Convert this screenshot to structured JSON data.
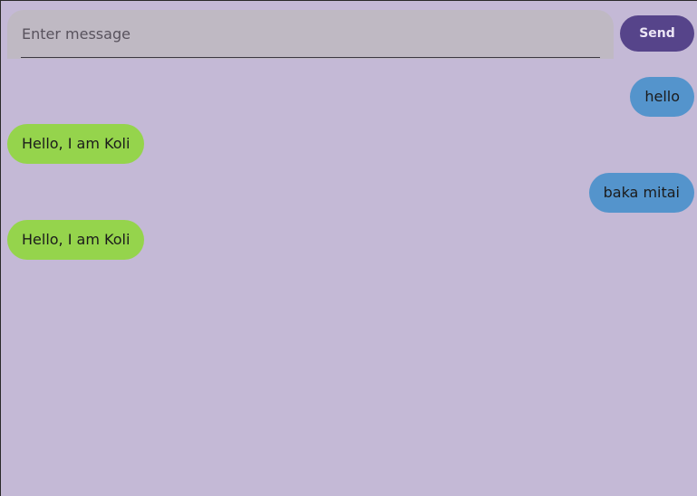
{
  "composer": {
    "placeholder": "Enter message",
    "value": "",
    "send_label": "Send"
  },
  "messages": [
    {
      "sender": "user",
      "text": "hello"
    },
    {
      "sender": "bot",
      "text": "Hello, I am Koli"
    },
    {
      "sender": "user",
      "text": "baka mitai"
    },
    {
      "sender": "bot",
      "text": "Hello, I am Koli"
    }
  ],
  "colors": {
    "background": "#c4b9d6",
    "input_background": "#bfb9c3",
    "send_button": "#56448a",
    "user_bubble": "#5494cc",
    "bot_bubble": "#95d44c"
  }
}
